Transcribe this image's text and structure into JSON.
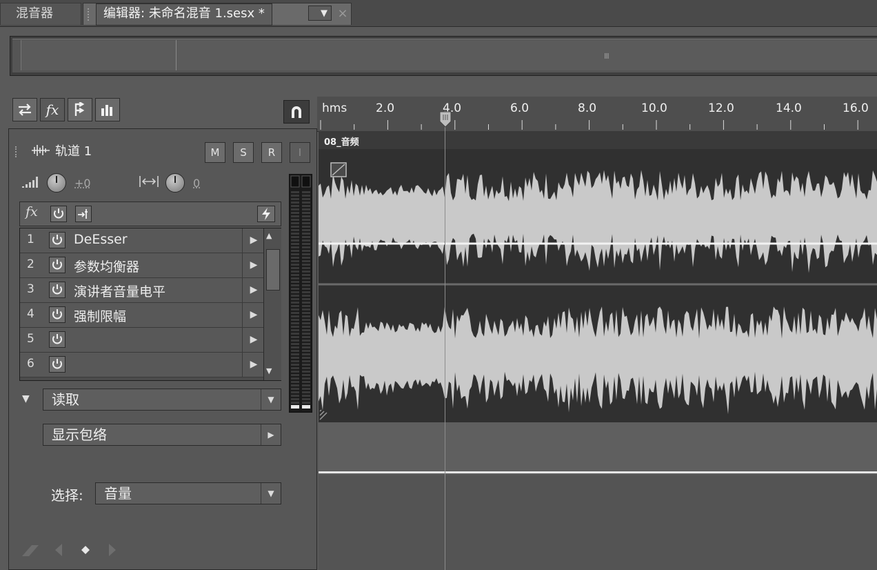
{
  "tabs": {
    "mixer_label": "混音器",
    "editor_label": "编辑器: 未命名混音 1.sesx *",
    "editor_dropdown": "▼",
    "editor_close": "×"
  },
  "overview": {
    "grip_label": "III"
  },
  "toolbar": {
    "icons": [
      "swap-icon",
      "fx-icon",
      "send-icon",
      "eq-icon"
    ],
    "fx_label": "fx",
    "snap_icon": "magnet-icon"
  },
  "track": {
    "name": "轨道 1",
    "mute_label": "M",
    "solo_label": "S",
    "record_label": "R",
    "input_label": "I",
    "volume_value": "+0",
    "pan_value": "0"
  },
  "fx_rack": {
    "header_fx": "fx",
    "slots": [
      {
        "num": "1",
        "name": "DeEsser"
      },
      {
        "num": "2",
        "name": "参数均衡器"
      },
      {
        "num": "3",
        "name": "演讲者音量电平"
      },
      {
        "num": "4",
        "name": "强制限幅"
      },
      {
        "num": "5",
        "name": ""
      },
      {
        "num": "6",
        "name": ""
      }
    ]
  },
  "automation": {
    "read_mode": "读取",
    "show_envelope": "显示包络",
    "select_label": "选择:",
    "select_value": "音量"
  },
  "ruler": {
    "unit": "hms",
    "ticks": [
      "2.0",
      "4.0",
      "6.0",
      "8.0",
      "10.0",
      "12.0",
      "14.0",
      "16.0"
    ]
  },
  "clip": {
    "name": "08_音频"
  },
  "colors": {
    "waveform": "#c9c9c9",
    "waveform_bg": "#303030",
    "panel": "#575757"
  }
}
